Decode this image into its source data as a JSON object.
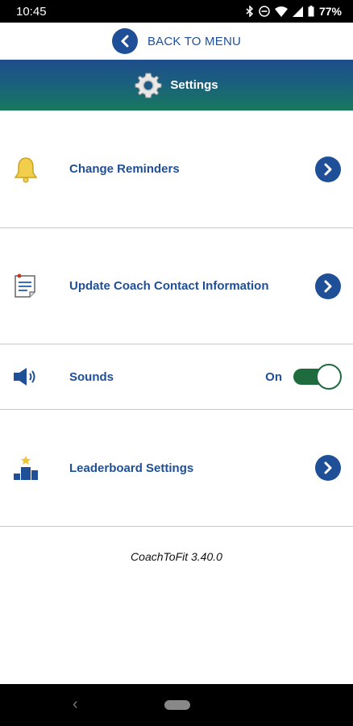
{
  "status": {
    "time": "10:45",
    "battery": "77%"
  },
  "back": {
    "label": "BACK TO MENU"
  },
  "header": {
    "title": "Settings"
  },
  "rows": [
    {
      "label": "Change Reminders",
      "icon": "bell-icon"
    },
    {
      "label": "Update Coach Contact Information",
      "icon": "contact-card-icon"
    },
    {
      "label": "Sounds",
      "icon": "speaker-icon",
      "toggle_label": "On",
      "toggle_on": true
    },
    {
      "label": "Leaderboard Settings",
      "icon": "leaderboard-icon"
    }
  ],
  "footer": {
    "version": "CoachToFit 3.40.0"
  },
  "colors": {
    "brand_blue": "#1f4f96",
    "toggle_green": "#1e6b3e",
    "header_gradient": [
      "#1f4d8c",
      "#17795c"
    ]
  }
}
